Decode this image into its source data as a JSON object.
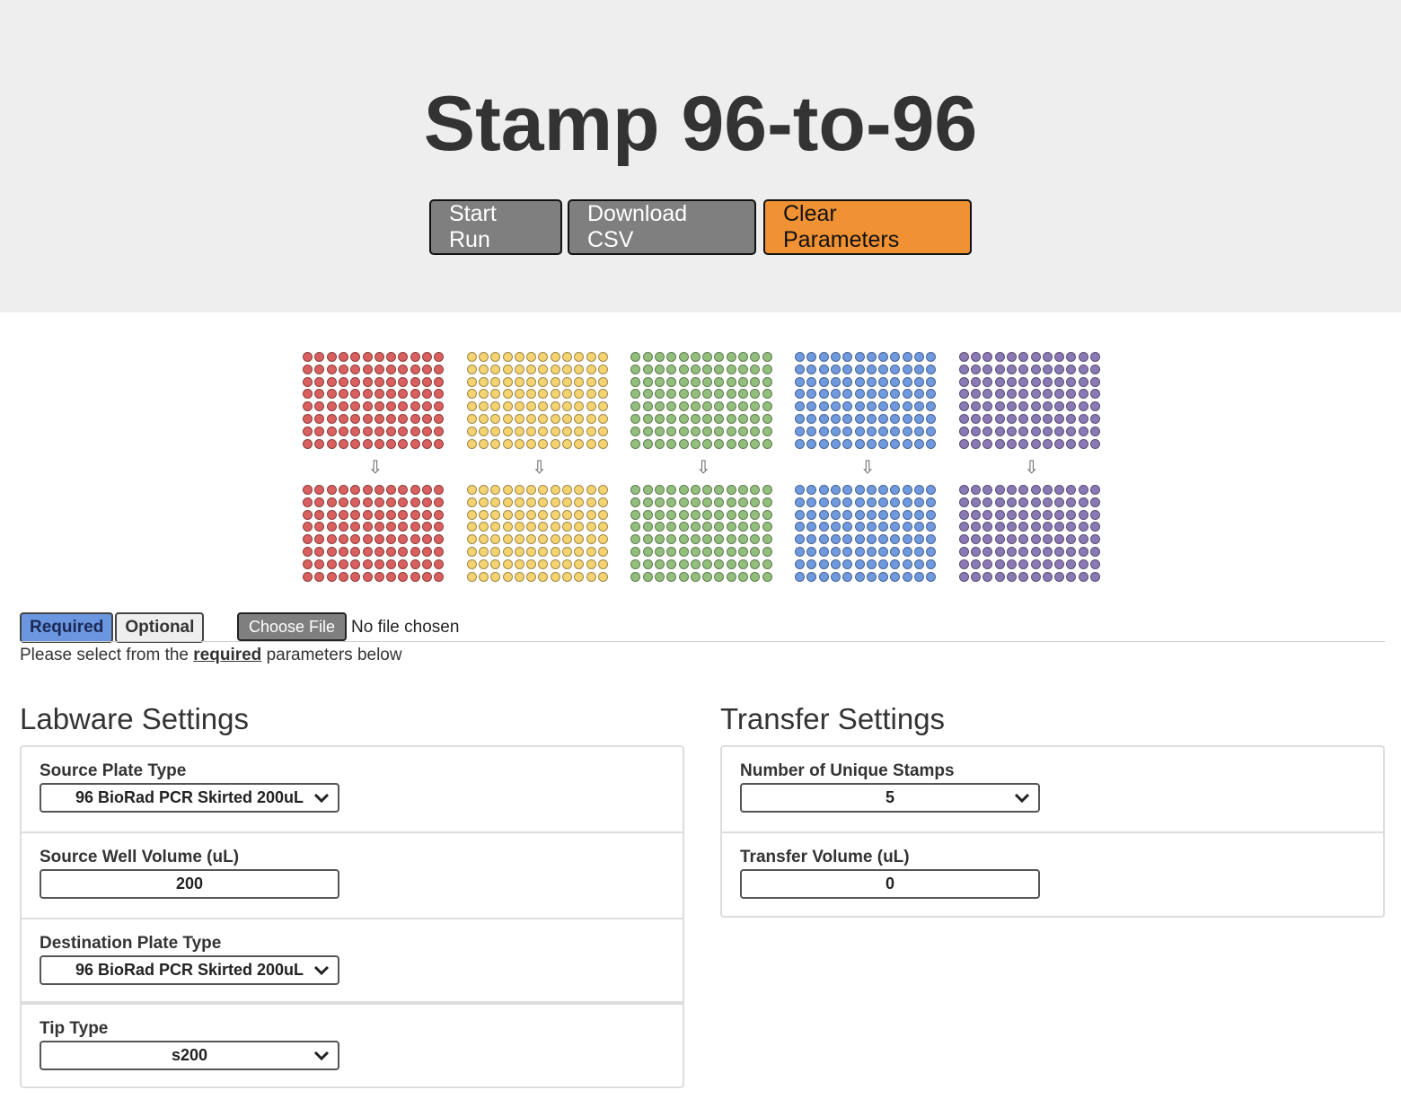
{
  "header": {
    "title": "Stamp 96-to-96",
    "buttons": {
      "start_run": "Start Run",
      "download_csv": "Download CSV",
      "clear_parameters": "Clear Parameters"
    }
  },
  "plates": {
    "colors": [
      "#d9605e",
      "#f5d370",
      "#93bf7c",
      "#6f9ae0",
      "#8a79b5"
    ],
    "rows": 8,
    "cols": 12,
    "arrow_glyph": "⇩"
  },
  "tabs": {
    "required": "Required",
    "optional": "Optional"
  },
  "file": {
    "button": "Choose File",
    "status": "No file chosen"
  },
  "hint": {
    "prefix": "Please select from the ",
    "emphasis": "required",
    "suffix": " parameters below"
  },
  "labware": {
    "title": "Labware Settings",
    "source_plate_type": {
      "label": "Source Plate Type",
      "value": "96 BioRad PCR Skirted 200uL"
    },
    "source_well_volume": {
      "label": "Source Well Volume (uL)",
      "value": "200"
    },
    "destination_plate_type": {
      "label": "Destination Plate Type",
      "value": "96 BioRad PCR Skirted 200uL"
    },
    "tip_type": {
      "label": "Tip Type",
      "value": "s200"
    }
  },
  "transfer": {
    "title": "Transfer Settings",
    "unique_stamps": {
      "label": "Number of Unique Stamps",
      "value": "5"
    },
    "transfer_volume": {
      "label": "Transfer Volume (uL)",
      "value": "0"
    }
  }
}
